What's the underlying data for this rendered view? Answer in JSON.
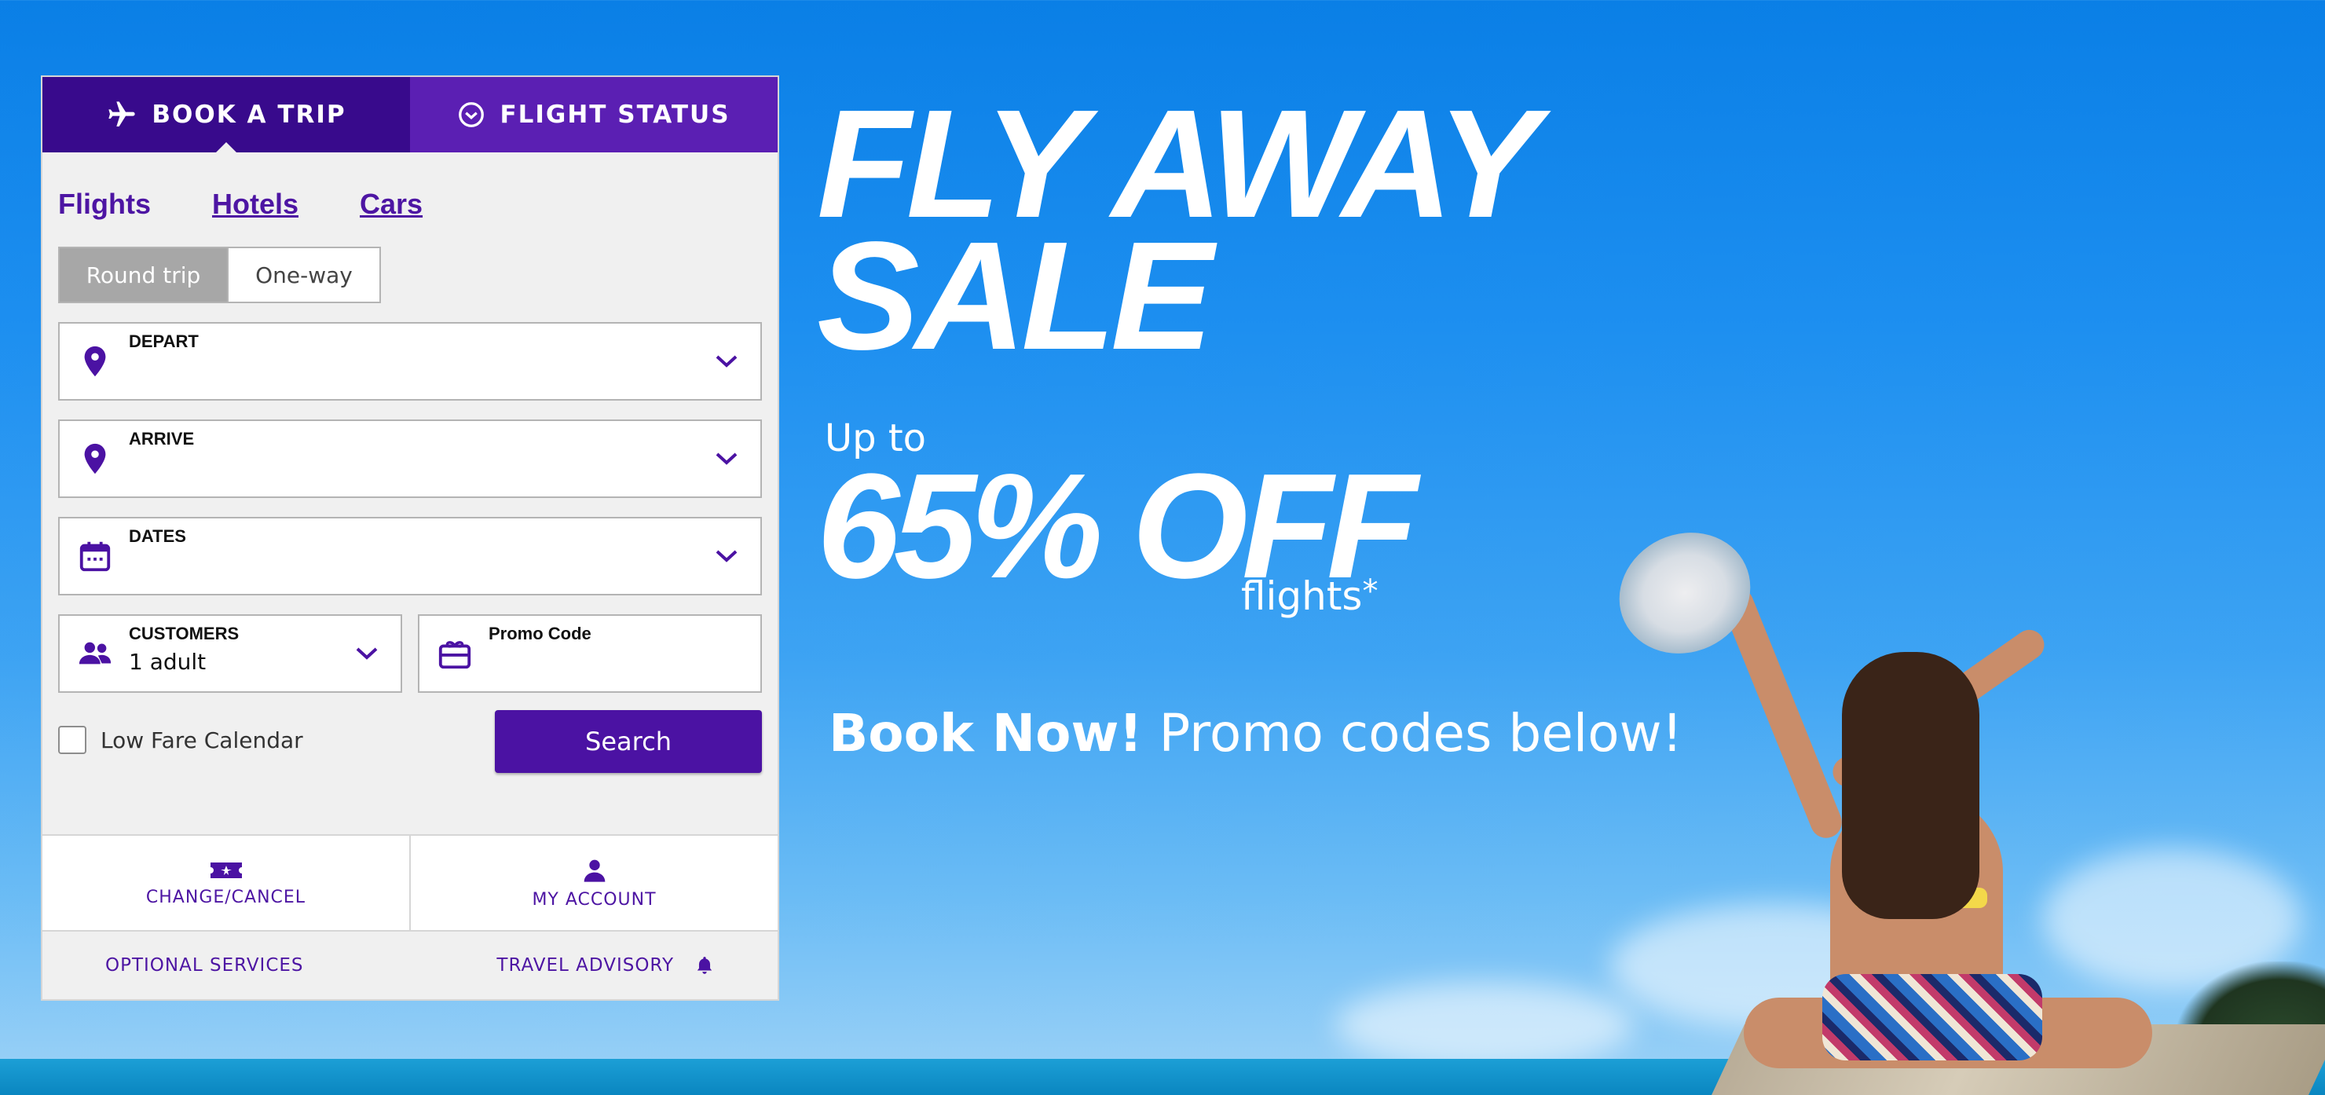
{
  "colors": {
    "accent": "#4b12a3",
    "tab_active": "#380a8c",
    "tab_inactive": "#5b1fb3",
    "link": "#4d15a3"
  },
  "widget": {
    "tabs": [
      {
        "label": "BOOK A TRIP",
        "icon": "airplane-icon",
        "active": true
      },
      {
        "label": "FLIGHT STATUS",
        "icon": "clock-check-icon",
        "active": false
      }
    ],
    "subnav": [
      {
        "label": "Flights",
        "current": true
      },
      {
        "label": "Hotels",
        "current": false
      },
      {
        "label": "Cars",
        "current": false
      }
    ],
    "trip_type": {
      "round_trip": "Round trip",
      "one_way": "One-way",
      "selected": "Round trip"
    },
    "fields": {
      "depart": {
        "label": "DEPART",
        "value": "",
        "icon": "location-pin-icon"
      },
      "arrive": {
        "label": "ARRIVE",
        "value": "",
        "icon": "location-pin-icon"
      },
      "dates": {
        "label": "DATES",
        "value": "",
        "icon": "calendar-icon"
      },
      "customers": {
        "label": "CUSTOMERS",
        "value": "1 adult",
        "icon": "people-icon"
      },
      "promo": {
        "label": "Promo Code",
        "value": "",
        "icon": "gift-card-icon"
      }
    },
    "low_fare_calendar": {
      "label": "Low Fare Calendar",
      "checked": false
    },
    "search_label": "Search",
    "quick_links": [
      {
        "label": "CHANGE/CANCEL",
        "icon": "ticket-icon"
      },
      {
        "label": "MY ACCOUNT",
        "icon": "person-icon"
      }
    ],
    "footer": {
      "optional_services": "OPTIONAL SERVICES",
      "travel_advisory": "TRAVEL ADVISORY",
      "advisory_icon": "bell-icon"
    }
  },
  "promo": {
    "headline_line1": "FLY AWAY",
    "headline_line2": "SALE",
    "up_to": "Up to",
    "discount": "65% OFF",
    "flights": "flights",
    "asterisk": "*",
    "book_now": "Book Now!",
    "tagline": "Promo codes below!"
  }
}
